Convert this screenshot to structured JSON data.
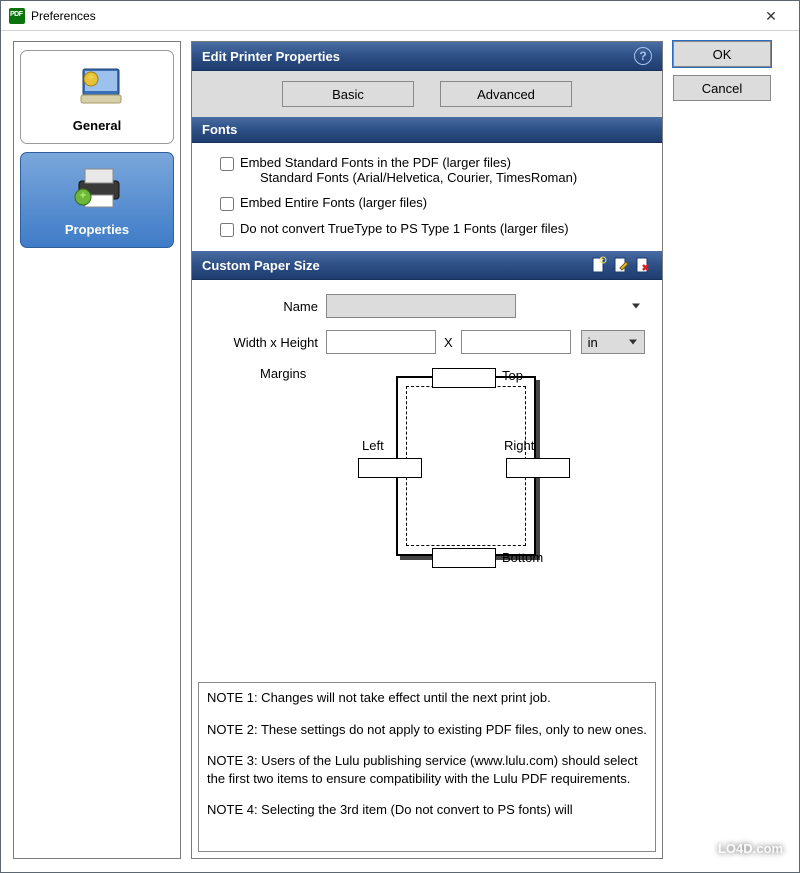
{
  "window": {
    "title": "Preferences"
  },
  "buttons": {
    "ok": "OK",
    "cancel": "Cancel"
  },
  "sidebar": {
    "tabs": [
      {
        "label": "General"
      },
      {
        "label": "Properties"
      }
    ]
  },
  "header": {
    "title": "Edit Printer Properties"
  },
  "mode_tabs": {
    "basic": "Basic",
    "advanced": "Advanced"
  },
  "fonts": {
    "heading": "Fonts",
    "embed_standard": "Embed Standard Fonts in the PDF (larger files)",
    "embed_standard_desc": "Standard Fonts (Arial/Helvetica, Courier, TimesRoman)",
    "embed_entire": "Embed Entire Fonts (larger files)",
    "no_convert": "Do not convert TrueType to PS Type 1 Fonts (larger files)"
  },
  "paper": {
    "heading": "Custom Paper Size",
    "name_label": "Name",
    "wh_label": "Width x Height",
    "x": "X",
    "unit": "in",
    "margins_label": "Margins",
    "top": "Top",
    "bottom": "Bottom",
    "left": "Left",
    "right": "Right"
  },
  "notes": {
    "n1": "NOTE 1: Changes will not take effect until the next print job.",
    "n2": "NOTE 2: These settings do not apply to existing PDF files, only to new ones.",
    "n3": "NOTE 3: Users of the Lulu publishing service (www.lulu.com) should select the first two items to ensure compatibility with the Lulu PDF requirements.",
    "n4": "NOTE 4: Selecting the 3rd item (Do not convert to PS fonts) will"
  },
  "watermark": "LO4D.com"
}
